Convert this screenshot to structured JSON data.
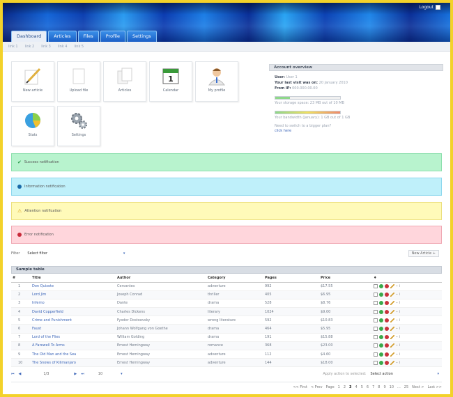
{
  "header": {
    "logout": "Logout"
  },
  "tabs": [
    "Dashboard",
    "Articles",
    "Files",
    "Profile",
    "Settings"
  ],
  "subnav": [
    "link 1",
    "link 2",
    "link 3",
    "link 4",
    "link 5"
  ],
  "shortcuts": [
    "New article",
    "Upload file",
    "Articles",
    "Calendar",
    "My profile",
    "Stats",
    "Settings"
  ],
  "calendar_day": "1",
  "account": {
    "title": "Account overview",
    "user_label": "User:",
    "user_value": "User 1",
    "last_visit_label": "Your last visit was on:",
    "last_visit_value": "20 January 2010",
    "from_ip_label": "From IP:",
    "from_ip_value": "000.000.00.00",
    "storage_text": "Your storage space: 23 MB out of 10 MB",
    "storage_fraction": 0.23,
    "bandwidth_text": "Your bandwidth (January): 1 GB out of 1 GB",
    "bandwidth_fraction": 1.0,
    "switch_text": "Need to switch to a bigger plan?",
    "click_here": "click here"
  },
  "notifications": {
    "success": "Success notification",
    "information": "Information notification",
    "attention": "Attention notification",
    "error": "Error notification"
  },
  "filter": {
    "label": "Filter",
    "select_value": "Select filter",
    "new_article": "New Article +"
  },
  "table": {
    "caption": "Sample table",
    "headers": [
      "#",
      "Title",
      "Author",
      "Category",
      "Pages",
      "Price"
    ],
    "rows": [
      [
        "1",
        "Don Quixote",
        "Cervantes",
        "adventure",
        "992",
        "$17.55"
      ],
      [
        "2",
        "Lord Jim",
        "Joseph Conrad",
        "thriller",
        "405",
        "$6.95"
      ],
      [
        "3",
        "Inferno",
        "Dante",
        "drama",
        "528",
        "$8.76"
      ],
      [
        "4",
        "David Copperfield",
        "Charles Dickens",
        "literary",
        "1024",
        "$9.00"
      ],
      [
        "5",
        "Crime and Punishment",
        "Fyodor Dostoevsky",
        "wrong literature",
        "592",
        "$10.83"
      ],
      [
        "6",
        "Faust",
        "Johann Wolfgang von Goethe",
        "drama",
        "464",
        "$5.95"
      ],
      [
        "7",
        "Lord of the Flies",
        "William Golding",
        "drama",
        "191",
        "$15.88"
      ],
      [
        "8",
        "A Farewell To Arms",
        "Ernest Hemingway",
        "romance",
        "368",
        "$23.00"
      ],
      [
        "9",
        "The Old Man and the Sea",
        "Ernest Hemingway",
        "adventure",
        "112",
        "$4.60"
      ],
      [
        "10",
        "The Snows of Kilimanjaro",
        "Ernest Hemingway",
        "adventure",
        "144",
        "$18.00"
      ]
    ]
  },
  "pager_controls": {
    "page_of": "1/3",
    "per_page": "10",
    "apply_label": "Apply action to selected:",
    "action_value": "Select action"
  },
  "pagination": {
    "first": "<< First",
    "prev": "< Prev",
    "page_label": "Page",
    "pages": [
      "1",
      "2",
      "3",
      "4",
      "5",
      "6",
      "7",
      "8",
      "9",
      "10"
    ],
    "ellipsis": "...",
    "last_num": "25",
    "next": "Next >",
    "last": "Last >>",
    "current": "3"
  },
  "colors": {
    "success": "#b8f3ce",
    "information": "#bff0fa",
    "attention": "#fffab9",
    "error": "#ffd6dc",
    "border": "#f3d22a"
  }
}
